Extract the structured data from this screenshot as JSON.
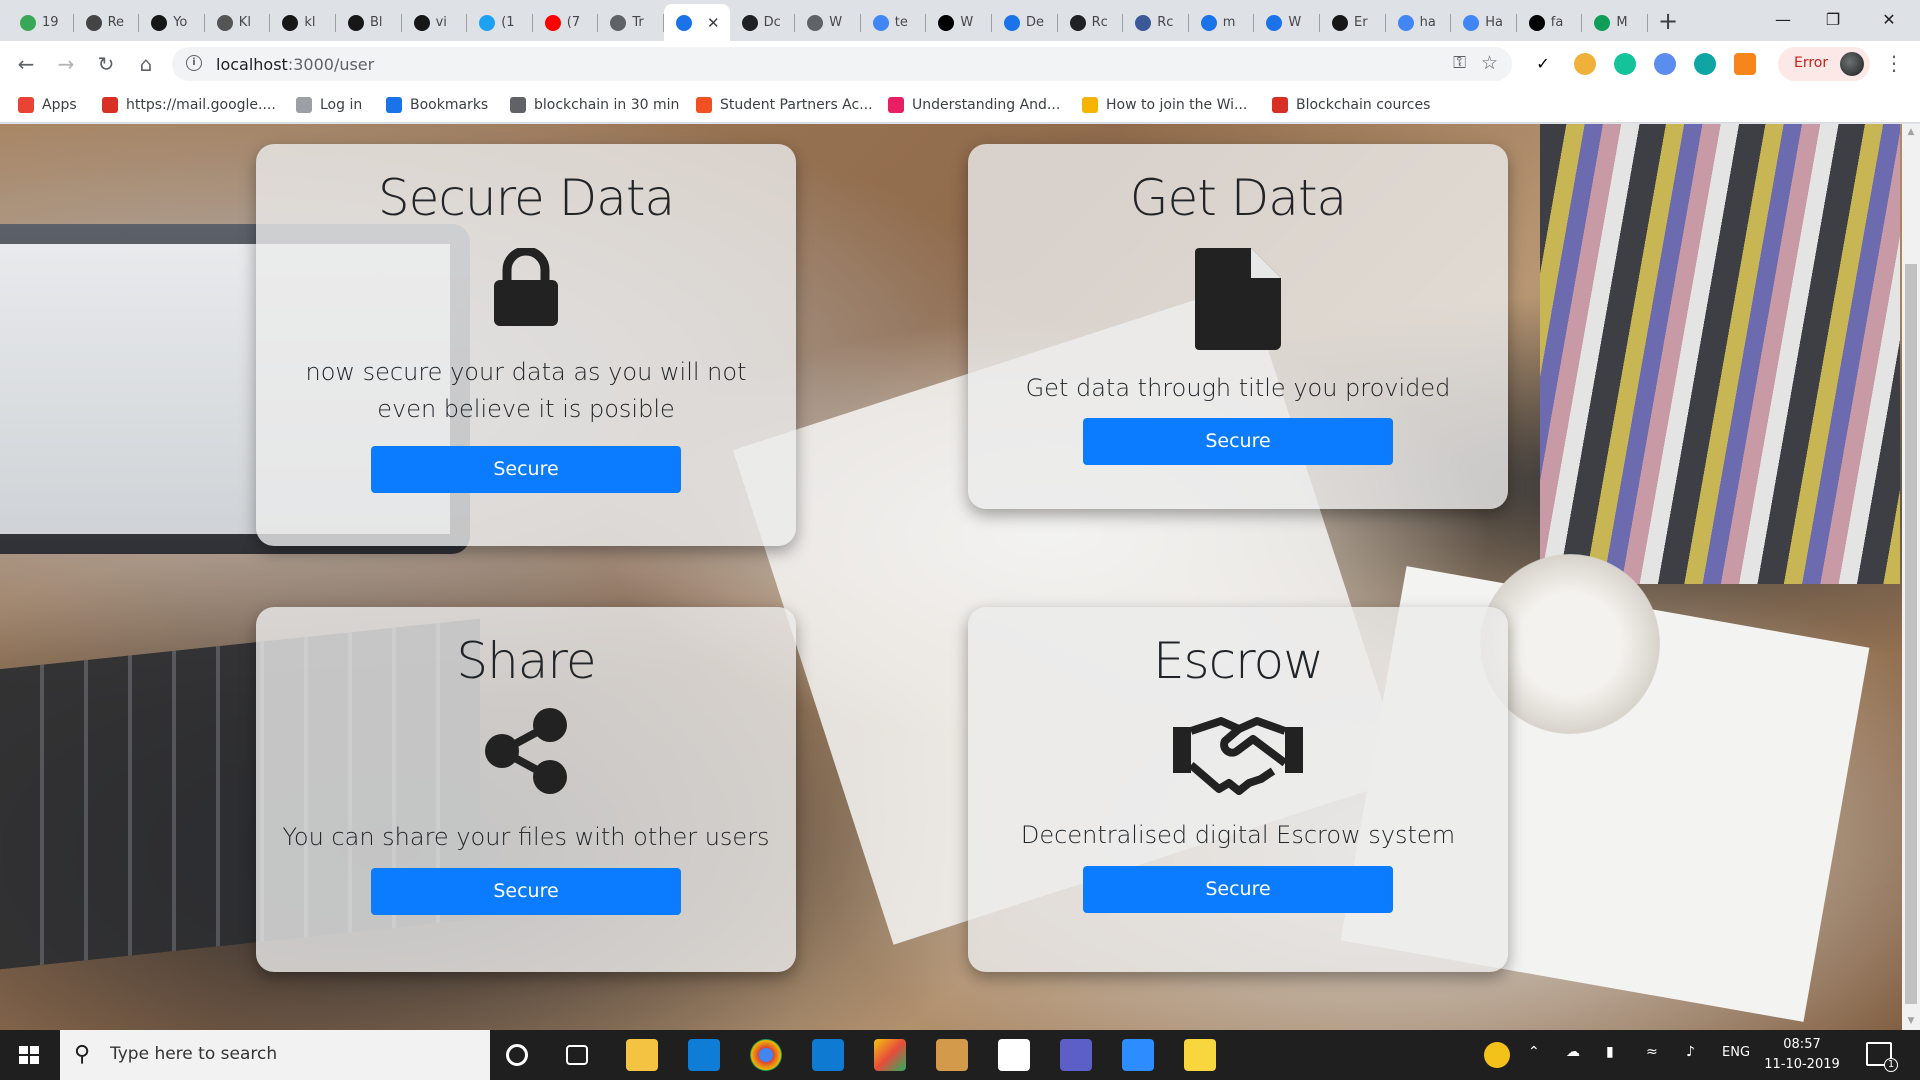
{
  "browser": {
    "tabs": [
      {
        "label": "19",
        "color": "#3aa757"
      },
      {
        "label": "Re",
        "color": "#444444"
      },
      {
        "label": "Yo",
        "color": "#181717"
      },
      {
        "label": "Kl",
        "color": "#555555"
      },
      {
        "label": "kl",
        "color": "#181717"
      },
      {
        "label": "Bl",
        "color": "#181717"
      },
      {
        "label": "vi",
        "color": "#181717"
      },
      {
        "label": "(1",
        "color": "#1da1f2"
      },
      {
        "label": "(7",
        "color": "#ff0000"
      },
      {
        "label": "Tr",
        "color": "#5f6368"
      },
      {
        "label": "",
        "color": "#1a73e8",
        "active": true
      },
      {
        "label": "Dc",
        "color": "#202124"
      },
      {
        "label": "W",
        "color": "#5f6368"
      },
      {
        "label": "te",
        "color": "#4285f4"
      },
      {
        "label": "W",
        "color": "#000000"
      },
      {
        "label": "De",
        "color": "#1a73e8"
      },
      {
        "label": "Rc",
        "color": "#202124"
      },
      {
        "label": "Rc",
        "color": "#3b5998"
      },
      {
        "label": "m",
        "color": "#1a73e8"
      },
      {
        "label": "W",
        "color": "#1a73e8"
      },
      {
        "label": "Er",
        "color": "#181717"
      },
      {
        "label": "ha",
        "color": "#4285f4"
      },
      {
        "label": "Ha",
        "color": "#4285f4"
      },
      {
        "label": "fa",
        "color": "#000000"
      },
      {
        "label": "M",
        "color": "#0f9d58"
      }
    ],
    "new_tab_symbol": "+",
    "window_controls": {
      "minimize": "—",
      "restore": "❐",
      "close": "✕"
    },
    "url_host": "localhost",
    "url_rest": ":3000/user",
    "error_label": "Error",
    "bookmarks": [
      {
        "label": "Apps",
        "icon": "apps-grid-icon",
        "color": "#ea4335"
      },
      {
        "label": "https://mail.google....",
        "icon": "gmail-icon",
        "color": "#d93025"
      },
      {
        "label": "Log in",
        "icon": "page-icon",
        "color": "#9aa0a6"
      },
      {
        "label": "Bookmarks",
        "icon": "star-icon",
        "color": "#1a73e8"
      },
      {
        "label": "blockchain in 30 min",
        "icon": "globe-icon",
        "color": "#5f6368"
      },
      {
        "label": "Student Partners Ac...",
        "icon": "microsoft-icon",
        "color": "#f25022"
      },
      {
        "label": "Understanding And...",
        "icon": "play-icon",
        "color": "#e91e63"
      },
      {
        "label": "How to join the Wi...",
        "icon": "w-logo-icon",
        "color": "#f4b400"
      },
      {
        "label": "Blockchain cources",
        "icon": "calendar-icon",
        "color": "#d93025"
      }
    ]
  },
  "page": {
    "cards": [
      {
        "title": "Secure Data",
        "icon": "lock-icon",
        "text": "now secure your data as you will not even believe it is posible",
        "button": "Secure"
      },
      {
        "title": "Get Data",
        "icon": "file-icon",
        "text": "Get data through title you provided",
        "button": "Secure"
      },
      {
        "title": "Share",
        "icon": "share-icon",
        "text": "You can share your files with other users",
        "button": "Secure"
      },
      {
        "title": "Escrow",
        "icon": "handshake-icon",
        "text": "Decentralised digital Escrow system",
        "button": "Secure"
      }
    ],
    "accent_color": "#0b7bff"
  },
  "taskbar": {
    "search_placeholder": "Type here to search",
    "language": "ENG",
    "time": "08:57",
    "date": "11-10-2019",
    "notification_count": "1"
  }
}
